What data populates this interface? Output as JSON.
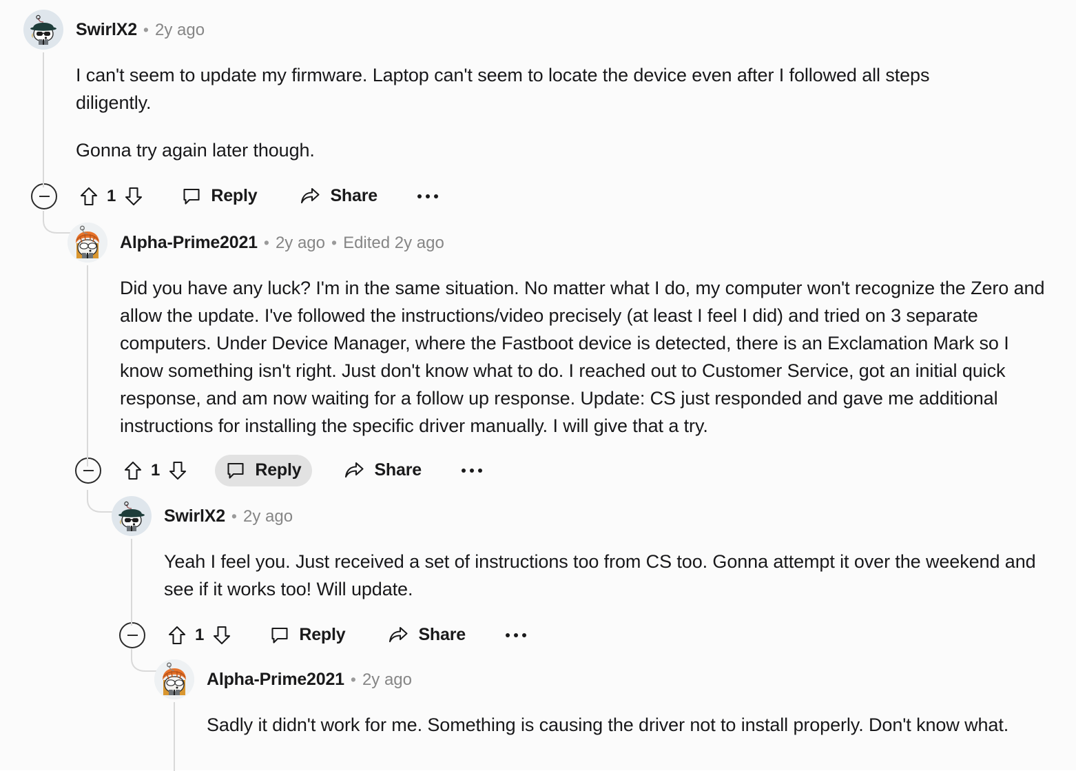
{
  "page": {
    "type": "reddit-comment-thread",
    "background_color": "#fbfbfb",
    "text_color": "#18181a",
    "muted_text_color": "#868686",
    "thread_line_color": "#d9d9d9",
    "hover_pill_color": "#e2e2e2"
  },
  "labels": {
    "reply": "Reply",
    "share": "Share",
    "separator": "•",
    "collapse": "collapse-thread",
    "upvote": "upvote",
    "downvote": "downvote",
    "more": "more-options"
  },
  "comments": [
    {
      "id": "c1",
      "depth": 0,
      "username": "SwirlX2",
      "timestamp": "2y ago",
      "edited": "",
      "vote_count": "1",
      "avatar": "snoo-hat-sunglasses",
      "reply_hovered": false,
      "paragraphs": [
        "I can't seem to update my firmware. Laptop can't seem to locate the device even after I followed all steps diligently.",
        "Gonna try again later though."
      ]
    },
    {
      "id": "c2",
      "depth": 1,
      "username": "Alpha-Prime2021",
      "timestamp": "2y ago",
      "edited": "Edited 2y ago",
      "vote_count": "1",
      "avatar": "snoo-orange-hair",
      "reply_hovered": true,
      "paragraphs": [
        "Did you have any luck? I'm in the same situation. No matter what I do, my computer won't recognize the Zero and allow the update. I've followed the instructions/video precisely (at least I feel I did) and tried on 3 separate computers. Under Device Manager, where the Fastboot device is detected, there is an Exclamation Mark so I know something isn't right. Just don't know what to do. I reached out to Customer Service, got an initial quick response, and am now waiting for a follow up response. Update: CS just responded and gave me additional instructions for installing the specific driver manually. I will give that a try."
      ]
    },
    {
      "id": "c3",
      "depth": 2,
      "username": "SwirlX2",
      "timestamp": "2y ago",
      "edited": "",
      "vote_count": "1",
      "avatar": "snoo-hat-sunglasses",
      "reply_hovered": false,
      "paragraphs": [
        "Yeah I feel you. Just received a set of instructions too from CS too. Gonna attempt it over the weekend and see if it works too! Will update."
      ]
    },
    {
      "id": "c4",
      "depth": 3,
      "username": "Alpha-Prime2021",
      "timestamp": "2y ago",
      "edited": "",
      "vote_count": "",
      "avatar": "snoo-orange-hair",
      "reply_hovered": false,
      "paragraphs": [
        "Sadly it didn't work for me. Something is causing the driver not to install properly. Don't know what."
      ]
    }
  ]
}
